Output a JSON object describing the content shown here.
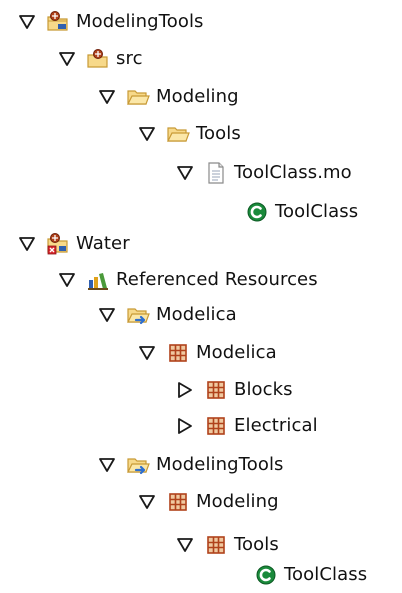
{
  "tree": {
    "project_modelingtools": {
      "label": "ModelingTools",
      "twisty_icon": "expanded-triangle-icon",
      "icon": "project-folder-icon"
    },
    "folder_src": {
      "label": "src",
      "twisty_icon": "expanded-triangle-icon",
      "icon": "source-folder-icon"
    },
    "package_modeling_src": {
      "label": "Modeling",
      "twisty_icon": "expanded-triangle-icon",
      "icon": "folder-icon"
    },
    "package_tools_src": {
      "label": "Tools",
      "twisty_icon": "expanded-triangle-icon",
      "icon": "folder-icon"
    },
    "file_toolclass": {
      "label": "ToolClass.mo",
      "twisty_icon": "expanded-triangle-icon",
      "icon": "file-icon"
    },
    "class_toolclass_src": {
      "label": "ToolClass",
      "icon": "class-icon"
    },
    "project_water": {
      "label": "Water",
      "twisty_icon": "expanded-triangle-icon",
      "icon": "project-error-icon"
    },
    "referenced_resources": {
      "label": "Referenced Resources",
      "twisty_icon": "expanded-triangle-icon",
      "icon": "library-icon"
    },
    "lib_modelica": {
      "label": "Modelica",
      "twisty_icon": "expanded-triangle-icon",
      "icon": "linked-folder-icon"
    },
    "pkg_modelica": {
      "label": "Modelica",
      "twisty_icon": "expanded-triangle-icon",
      "icon": "package-icon"
    },
    "pkg_blocks": {
      "label": "Blocks",
      "twisty_icon": "collapsed-triangle-icon",
      "icon": "package-icon"
    },
    "pkg_electrical": {
      "label": "Electrical",
      "twisty_icon": "collapsed-triangle-icon",
      "icon": "package-icon"
    },
    "lib_modelingtools": {
      "label": "ModelingTools",
      "twisty_icon": "expanded-triangle-icon",
      "icon": "linked-folder-icon"
    },
    "pkg_modeling": {
      "label": "Modeling",
      "twisty_icon": "expanded-triangle-icon",
      "icon": "package-icon"
    },
    "pkg_tools": {
      "label": "Tools",
      "twisty_icon": "expanded-triangle-icon",
      "icon": "package-icon"
    },
    "class_toolclass_lib": {
      "label": "ToolClass",
      "icon": "class-icon"
    }
  },
  "colors": {
    "twisty_stroke": "#1a1a1a",
    "folder_fill": "#f7d98a",
    "folder_stroke": "#c89a36",
    "package_fill": "#e8b48a",
    "package_stroke": "#b0421b",
    "class_green": "#1a8a3b",
    "project_blue": "#2f5fb0",
    "error_red": "#d8272d"
  }
}
